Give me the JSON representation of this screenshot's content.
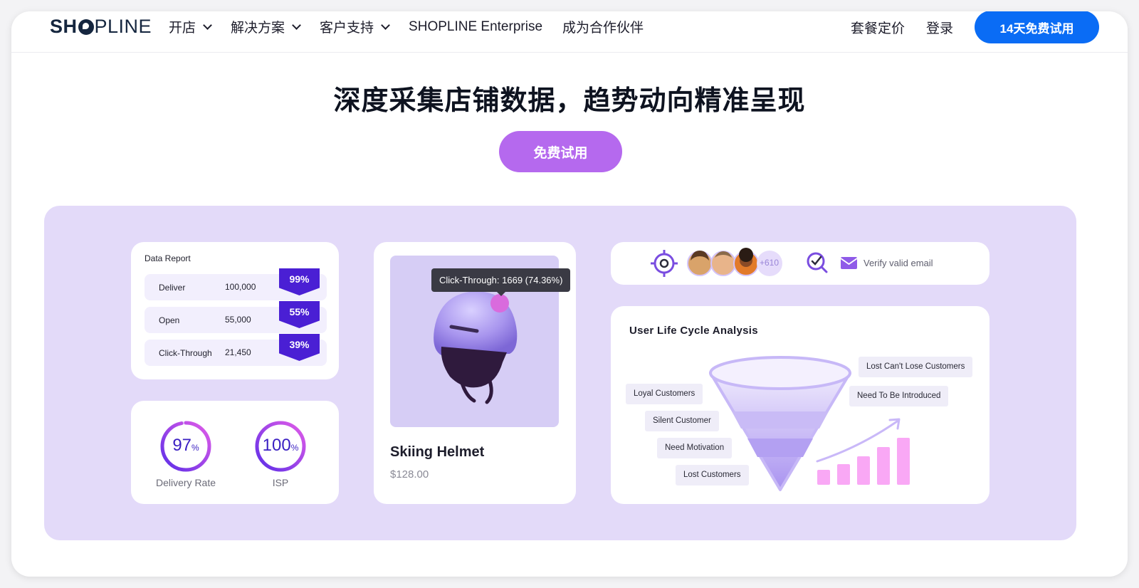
{
  "header": {
    "logo": {
      "prefix": "SH",
      "suffix": "PLINE",
      "icon": "shopline-o-logo-icon"
    },
    "nav": [
      {
        "label": "开店",
        "has_dropdown": true
      },
      {
        "label": "解决方案",
        "has_dropdown": true
      },
      {
        "label": "客户支持",
        "has_dropdown": true
      },
      {
        "label": "SHOPLINE Enterprise",
        "has_dropdown": false
      },
      {
        "label": "成为合作伙伴",
        "has_dropdown": false
      }
    ],
    "pricing": "套餐定价",
    "login": "登录",
    "trial_button": "14天免费试用"
  },
  "hero": {
    "title": "深度采集店铺数据，趋势动向精准呈现",
    "cta": "免费试用"
  },
  "report": {
    "title": "Data Report",
    "rows": [
      {
        "label": "Deliver",
        "value": "100,000",
        "percent": "99%"
      },
      {
        "label": "Open",
        "value": "55,000",
        "percent": "55%"
      },
      {
        "label": "Click-Through",
        "value": "21,450",
        "percent": "39%"
      }
    ]
  },
  "rates": [
    {
      "value": "97",
      "unit": "%",
      "label": "Delivery Rate",
      "fraction": 0.97
    },
    {
      "value": "100",
      "unit": "%",
      "label": "ISP",
      "fraction": 1.0
    }
  ],
  "product": {
    "tooltip": "Click-Through: 1669 (74.36%)",
    "name": "Skiing Helmet",
    "price": "$128.00"
  },
  "segment": {
    "more_count": "+610",
    "verify_label": "Verify valid email",
    "icons": [
      "target-icon",
      "avatar",
      "search-check-icon",
      "mail-icon"
    ]
  },
  "lifecycle": {
    "title": "User Life Cycle Analysis",
    "left_labels": [
      "Loyal Customers",
      "Silent Customer",
      "Need Motivation",
      "Lost Customers"
    ],
    "right_labels": [
      "Lost Can't Lose Customers",
      "Need To Be Introduced"
    ]
  },
  "colors": {
    "primary_blue": "#0a6cf5",
    "cta_purple": "#b569ee",
    "showcase_bg": "#e3daf9",
    "tag_purple": "#4a1fd4",
    "bar_pink": "#f9a8f5"
  }
}
